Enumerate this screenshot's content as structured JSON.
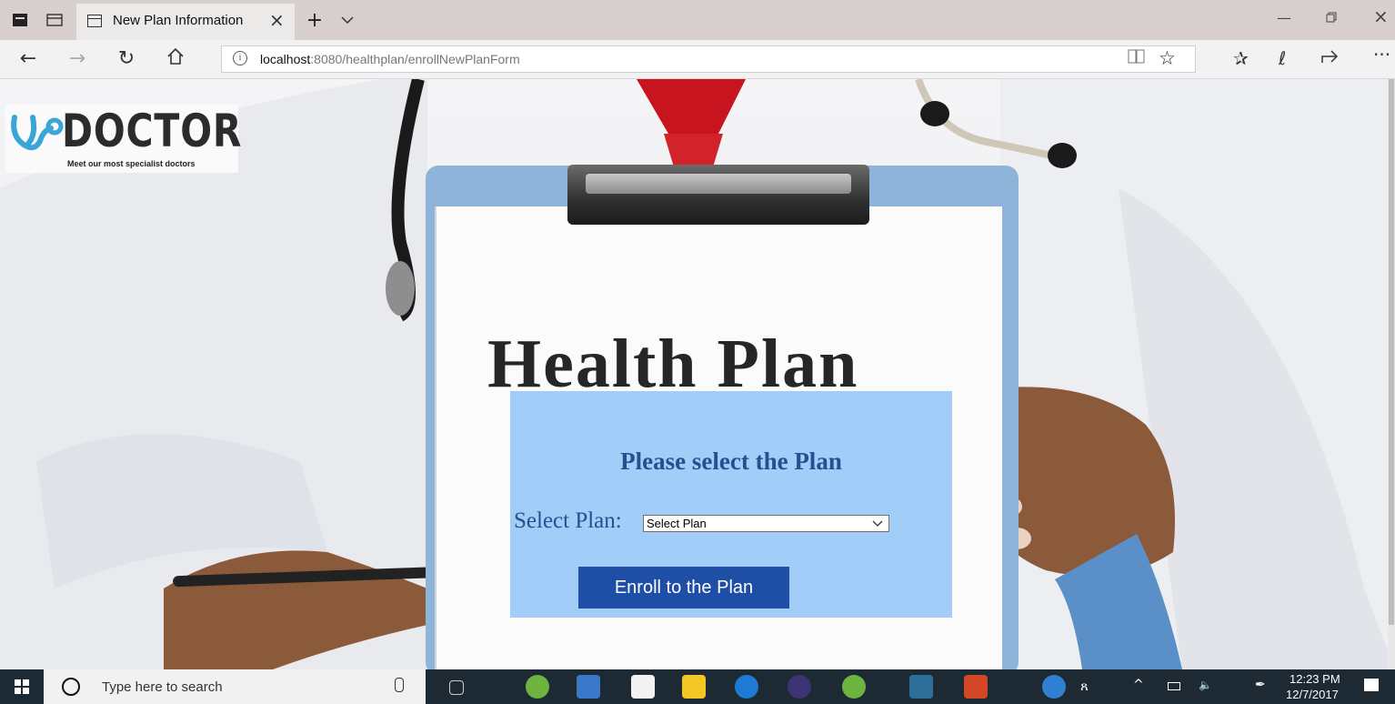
{
  "browser": {
    "tab_title": "New Plan Information",
    "url_host": "localhost",
    "url_path": ":8080/healthplan/enrollNewPlanForm"
  },
  "logo": {
    "word": "DOCTOR",
    "tagline": "Meet our most specialist doctors"
  },
  "page": {
    "heading_image_text": "Health Plan",
    "form": {
      "heading": "Please select the Plan",
      "select_label": "Select Plan:",
      "select_value": "Select Plan",
      "submit_label": "Enroll to the Plan"
    },
    "colors": {
      "form_background": "#a3cdf9",
      "heading_text": "#24508f",
      "button_background": "#1f4ea6"
    }
  },
  "taskbar": {
    "search_placeholder": "Type here to search",
    "time": "12:23 PM",
    "date": "12/7/2017",
    "icons": [
      "windows-start-icon",
      "cortana-icon",
      "task-view-icon",
      "spring-tool-icon",
      "network-icon",
      "store-icon",
      "file-explorer-icon",
      "edge-icon",
      "eclipse-icon",
      "spring-tool-2-icon",
      "mysql-workbench-icon",
      "powerpoint-icon",
      "help-icon",
      "people-icon",
      "show-hidden-icon",
      "battery-icon",
      "volume-icon",
      "pen-icon",
      "notifications-icon"
    ]
  }
}
